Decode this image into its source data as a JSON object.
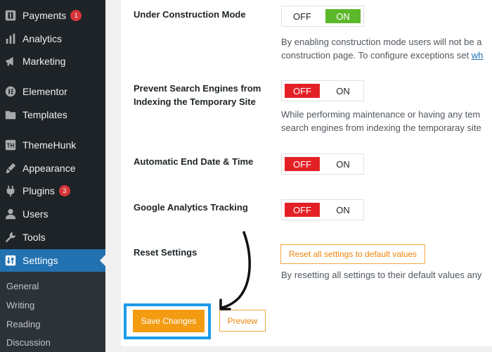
{
  "sidebar": {
    "items": [
      {
        "label": "Payments",
        "icon": "payments-icon",
        "badge": "1"
      },
      {
        "label": "Analytics",
        "icon": "analytics-icon"
      },
      {
        "label": "Marketing",
        "icon": "megaphone-icon"
      },
      {
        "label": "Elementor",
        "icon": "elementor-icon"
      },
      {
        "label": "Templates",
        "icon": "folder-icon"
      },
      {
        "label": "ThemeHunk",
        "icon": "themehunk-icon"
      },
      {
        "label": "Appearance",
        "icon": "paintbrush-icon"
      },
      {
        "label": "Plugins",
        "icon": "plugin-icon",
        "badge": "3"
      },
      {
        "label": "Users",
        "icon": "user-icon"
      },
      {
        "label": "Tools",
        "icon": "wrench-icon"
      },
      {
        "label": "Settings",
        "icon": "settings-icon",
        "active": true
      }
    ],
    "submenu": [
      "General",
      "Writing",
      "Reading",
      "Discussion"
    ]
  },
  "settings": {
    "rows": [
      {
        "label_lines": [
          "Under Construction Mode"
        ],
        "off_label": "OFF",
        "on_label": "ON",
        "state": "on",
        "desc_lines": [
          "By enabling construction mode users will not be a",
          "construction page. To configure exceptions set "
        ],
        "desc_link": "wh"
      },
      {
        "label_lines": [
          "Prevent Search Engines from",
          "Indexing the Temporary Site"
        ],
        "off_label": "OFF",
        "on_label": "ON",
        "state": "off",
        "desc_lines": [
          "While performing maintenance or having any tem",
          "search engines from indexing the temporaray site"
        ]
      },
      {
        "label_lines": [
          "Automatic End Date & Time"
        ],
        "off_label": "OFF",
        "on_label": "ON",
        "state": "off"
      },
      {
        "label_lines": [
          "Google Analytics Tracking"
        ],
        "off_label": "OFF",
        "on_label": "ON",
        "state": "off"
      }
    ],
    "reset": {
      "label": "Reset Settings",
      "button": "Reset all settings to default values",
      "desc": "By resetting all settings to their default values any"
    },
    "save_button": "Save Changes",
    "preview_button": "Preview"
  },
  "colors": {
    "sidebar_bg": "#1d2327",
    "active_menu": "#2271b1",
    "toggle_on": "#5cb82a",
    "toggle_off": "#e32125",
    "accent_orange": "#f39c12",
    "highlight_blue": "#1d9be8"
  }
}
